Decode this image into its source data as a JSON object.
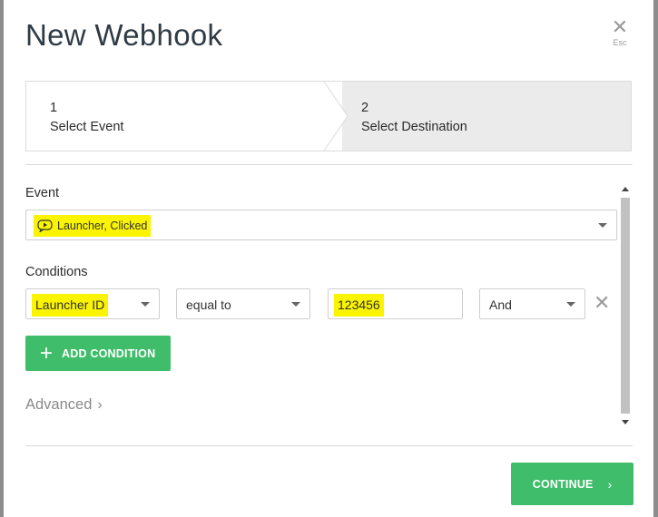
{
  "dialog": {
    "title": "New Webhook",
    "close_label": "Esc"
  },
  "steps": [
    {
      "number": "1",
      "label": "Select Event",
      "active": true
    },
    {
      "number": "2",
      "label": "Select Destination",
      "active": false
    }
  ],
  "event": {
    "label": "Event",
    "value": "Launcher, Clicked",
    "icon": "video-play-icon"
  },
  "conditions": {
    "label": "Conditions",
    "rows": [
      {
        "field": "Launcher ID",
        "operator": "equal to",
        "value": "123456",
        "join": "And"
      }
    ],
    "add_label": "ADD CONDITION"
  },
  "advanced_label": "Advanced",
  "continue_label": "CONTINUE",
  "colors": {
    "accent_green": "#3fbd6b",
    "highlight": "#fbf400",
    "overlay": "#8d8d8d"
  }
}
